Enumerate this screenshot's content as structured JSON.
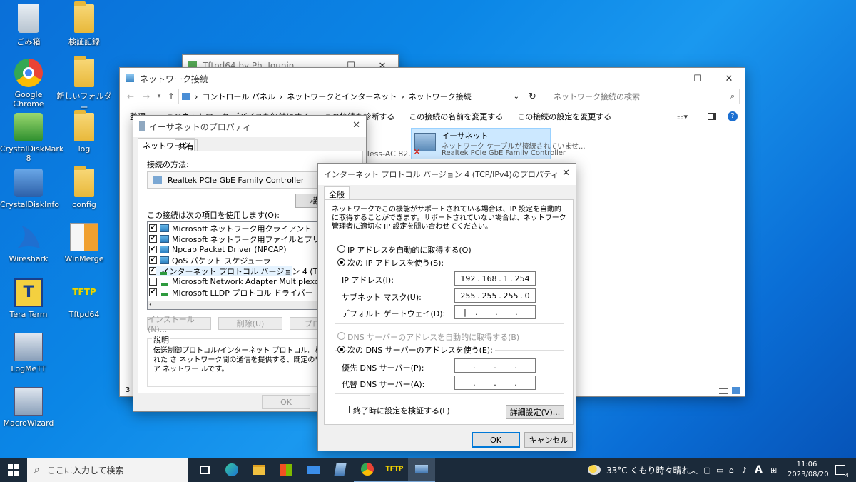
{
  "desktop_icons": [
    {
      "label": "ごみ箱",
      "icon": "recycle-bin-icon"
    },
    {
      "label": "検証記録",
      "icon": "folder-icon"
    },
    {
      "label": "Google Chrome",
      "icon": "chrome-icon"
    },
    {
      "label": "新しいフォルダー",
      "icon": "folder-icon"
    },
    {
      "label": "CrystalDiskMark 8",
      "icon": "crystaldiskmark-icon"
    },
    {
      "label": "log",
      "icon": "folder-icon"
    },
    {
      "label": "CrystalDiskInfo",
      "icon": "crystaldiskinfo-icon"
    },
    {
      "label": "config",
      "icon": "folder-icon"
    },
    {
      "label": "Wireshark",
      "icon": "wireshark-icon"
    },
    {
      "label": "WinMerge",
      "icon": "winmerge-icon"
    },
    {
      "label": "Tera Term",
      "icon": "teraterm-icon"
    },
    {
      "label": "Tftpd64",
      "icon": "tftpd64-icon"
    },
    {
      "label": "LogMeTT",
      "icon": "logmett-icon"
    },
    {
      "label": "MacroWizard",
      "icon": "macrowizard-icon"
    }
  ],
  "tftpd_window": {
    "title": "Tftpd64 by Ph. Jounin"
  },
  "explorer": {
    "title": "ネットワーク接続",
    "breadcrumb": [
      "コントロール パネル",
      "ネットワークとインターネット",
      "ネットワーク接続"
    ],
    "search_placeholder": "ネットワーク接続の検索",
    "commands": [
      "整理 ▾",
      "このネットワーク デバイスを無効にする",
      "この接続を診断する",
      "この接続の名前を変更する",
      "この接続の設定を変更する"
    ],
    "adapter": {
      "name": "イーサネット",
      "status": "ネットワーク ケーブルが接続されていませ...",
      "device": "Realtek PCIe GbE Family Controller"
    },
    "wifi_partial": "eless-AC 82...",
    "status_count": "3"
  },
  "eth_props": {
    "title": "イーサネットのプロパティ",
    "tabs": [
      "ネットワーク",
      "共有"
    ],
    "connect_using_label": "接続の方法:",
    "adapter_name": "Realtek PCIe GbE Family Controller",
    "configure_btn": "構",
    "items_label": "この接続は次の項目を使用します(O):",
    "items": [
      {
        "label": "Microsoft ネットワーク用クライアント",
        "checked": true,
        "type": "net"
      },
      {
        "label": "Microsoft ネットワーク用ファイルとプリンター共有",
        "checked": true,
        "type": "net"
      },
      {
        "label": "Npcap Packet Driver (NPCAP)",
        "checked": true,
        "type": "net"
      },
      {
        "label": "QoS パケット スケジューラ",
        "checked": true,
        "type": "net"
      },
      {
        "label": "インターネット プロトコル バージョン 4 (TCP/IPv4)",
        "checked": true,
        "type": "proto"
      },
      {
        "label": "Microsoft Network Adapter Multiplexor Protocol",
        "checked": false,
        "type": "proto"
      },
      {
        "label": "Microsoft LLDP プロトコル ドライバー",
        "checked": true,
        "type": "proto"
      }
    ],
    "install_btn": "インストール(N)...",
    "uninstall_btn": "削除(U)",
    "props_btn": "プロ",
    "desc_label": "説明",
    "desc_text": "伝送制御プロトコル/インターネット プロトコル。相互接続された さ ネットワーク間の通信を提供する、既定のワイド エリア ネットワー ルです。",
    "ok_btn": "OK"
  },
  "ipv4": {
    "title": "インターネット プロトコル バージョン 4 (TCP/IPv4)のプロパティ",
    "tab": "全般",
    "intro": "ネットワークでこの機能がサポートされている場合は、IP 設定を自動的に取得することができます。サポートされていない場合は、ネットワーク管理者に適切な IP 設定を問い合わせてください。",
    "auto_ip": "IP アドレスを自動的に取得する(O)",
    "manual_ip": "次の IP アドレスを使う(S):",
    "ip_label": "IP アドレス(I):",
    "ip": [
      "192",
      "168",
      "1",
      "254"
    ],
    "mask_label": "サブネット マスク(U):",
    "mask": [
      "255",
      "255",
      "255",
      "0"
    ],
    "gw_label": "デフォルト ゲートウェイ(D):",
    "gw": [
      "",
      "",
      "",
      ""
    ],
    "auto_dns": "DNS サーバーのアドレスを自動的に取得する(B)",
    "manual_dns": "次の DNS サーバーのアドレスを使う(E):",
    "pref_dns_label": "優先 DNS サーバー(P):",
    "alt_dns_label": "代替 DNS サーバー(A):",
    "validate": "終了時に設定を検証する(L)",
    "advanced_btn": "詳細設定(V)...",
    "ok_btn": "OK",
    "cancel_btn": "キャンセル"
  },
  "taskbar": {
    "search_placeholder": "ここに入力して検索",
    "weather": "33°C くもり時々晴れ",
    "ime": "A",
    "time": "11:06",
    "date": "2023/08/20",
    "notif_count": "4"
  }
}
